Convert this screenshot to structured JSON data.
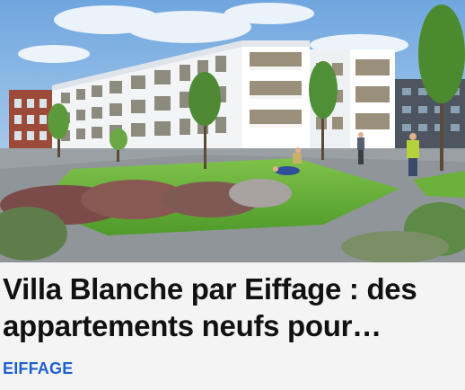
{
  "article": {
    "title": "Villa Blanche par Eiffage : des appartements neufs pour…",
    "source": "EIFFAGE"
  },
  "colors": {
    "title": "#111111",
    "source_link": "#1e5fd3",
    "background": "#f4f4f4"
  }
}
